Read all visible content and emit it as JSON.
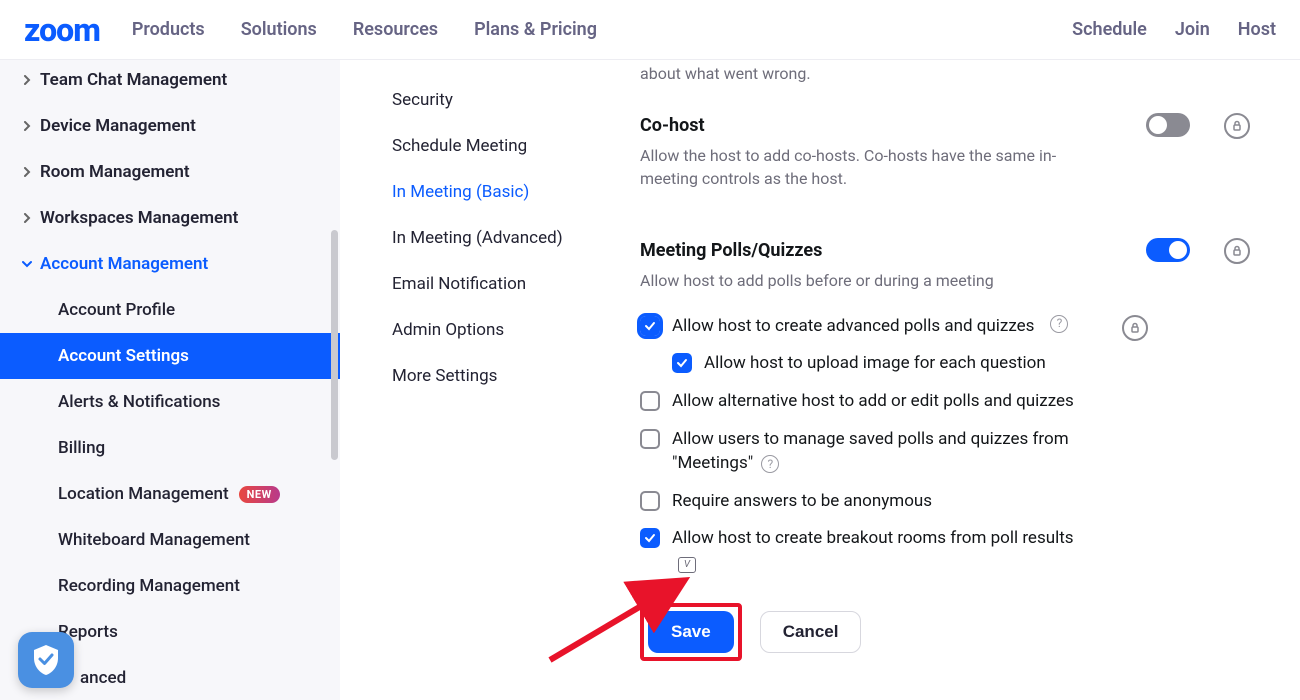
{
  "header": {
    "logo": "zoom",
    "nav": [
      "Products",
      "Solutions",
      "Resources",
      "Plans & Pricing"
    ],
    "right": [
      "Schedule",
      "Join",
      "Host"
    ]
  },
  "sidebar": {
    "items": [
      {
        "label": "Team Chat Management",
        "expanded": false
      },
      {
        "label": "Device Management",
        "expanded": false
      },
      {
        "label": "Room Management",
        "expanded": false
      },
      {
        "label": "Workspaces Management",
        "expanded": false
      },
      {
        "label": "Account Management",
        "expanded": true
      }
    ],
    "sub": [
      {
        "label": "Account Profile",
        "active": false
      },
      {
        "label": "Account Settings",
        "active": true
      },
      {
        "label": "Alerts & Notifications",
        "active": false
      },
      {
        "label": "Billing",
        "active": false
      },
      {
        "label": "Location Management",
        "active": false,
        "badge": "NEW"
      },
      {
        "label": "Whiteboard Management",
        "active": false
      },
      {
        "label": "Recording Management",
        "active": false
      },
      {
        "label": "Reports",
        "active": false
      },
      {
        "label": "anced",
        "active": false
      }
    ]
  },
  "midnav": {
    "items": [
      {
        "label": "Security",
        "active": false
      },
      {
        "label": "Schedule Meeting",
        "active": false
      },
      {
        "label": "In Meeting (Basic)",
        "active": true
      },
      {
        "label": "In Meeting (Advanced)",
        "active": false
      },
      {
        "label": "Email Notification",
        "active": false
      },
      {
        "label": "Admin Options",
        "active": false
      },
      {
        "label": "More Settings",
        "active": false
      }
    ]
  },
  "main": {
    "faded_partial": "about what went wrong.",
    "cohost": {
      "title": "Co-host",
      "desc": "Allow the host to add co-hosts. Co-hosts have the same in-meeting controls as the host."
    },
    "polls": {
      "title": "Meeting Polls/Quizzes",
      "desc": "Allow host to add polls before or during a meeting",
      "opts": [
        {
          "label": "Allow host to create advanced polls and quizzes",
          "checked": true,
          "help": true,
          "lock": true,
          "highlighted": true
        },
        {
          "label": "Allow host to upload image for each question",
          "checked": true,
          "indent": true
        },
        {
          "label": "Allow alternative host to add or edit polls and quizzes",
          "checked": false
        },
        {
          "label": "Allow users to manage saved polls and quizzes from \"Meetings\"",
          "checked": false,
          "help": true
        },
        {
          "label": "Require answers to be anonymous",
          "checked": false
        },
        {
          "label": "Allow host to create breakout rooms from poll results",
          "checked": true,
          "vicon": true
        }
      ]
    },
    "buttons": {
      "save": "Save",
      "cancel": "Cancel"
    }
  }
}
